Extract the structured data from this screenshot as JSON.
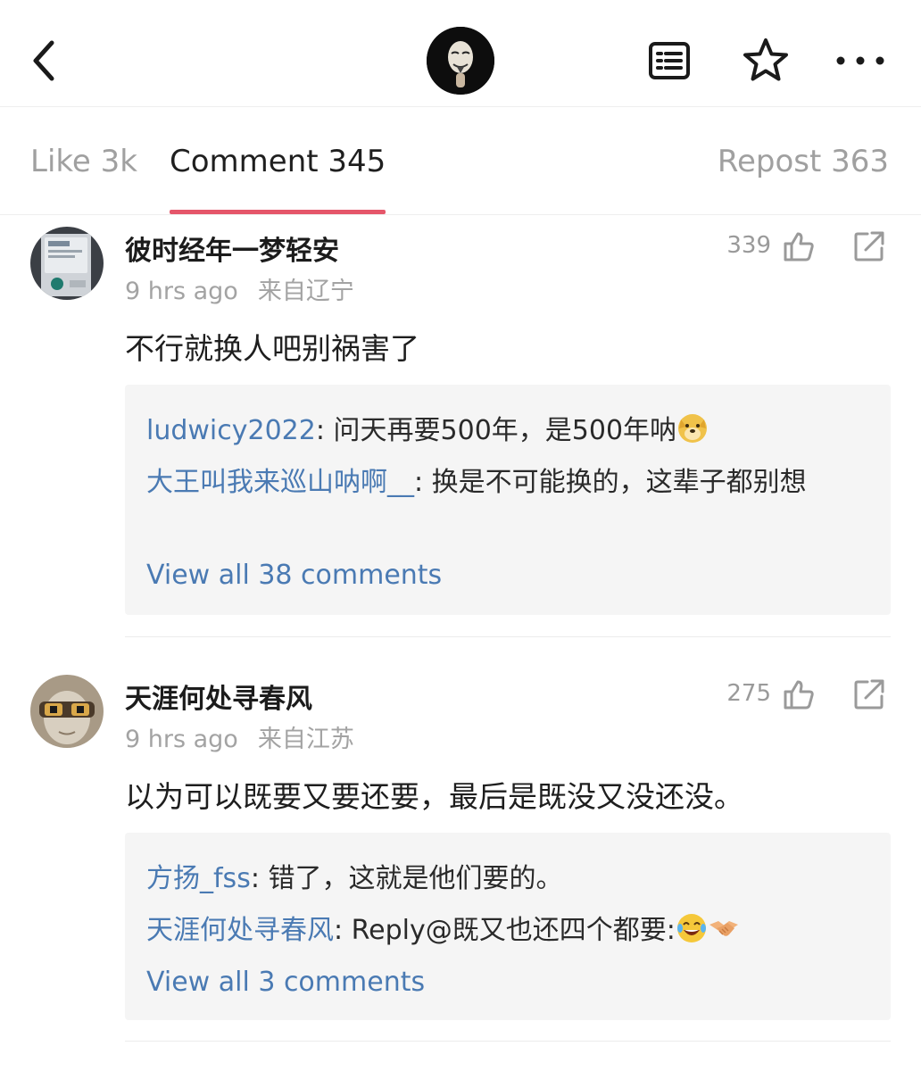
{
  "header": {
    "back_icon": "chevron-left-icon",
    "reader_icon": "reader-icon",
    "star_icon": "star-icon",
    "more_icon": "more-dots-icon"
  },
  "tabs": [
    {
      "label": "Like 3k",
      "active": false
    },
    {
      "label": "Comment 345",
      "active": true
    },
    {
      "label": "Repost 363",
      "active": false
    }
  ],
  "colors": {
    "accent": "#e5566a",
    "link": "#4a7ab3",
    "muted": "#a3a3a3",
    "reply_bg": "#f5f5f5"
  },
  "comments": [
    {
      "username": "彼时经年一梦轻安",
      "time": "9 hrs ago",
      "location": "来自辽宁",
      "likes": "339",
      "text": "不行就换人吧别祸害了",
      "replies": [
        {
          "user": "ludwicy2022",
          "sep": ": ",
          "text": "问天再要500年，是500年呐",
          "emoji": "doge-emoji"
        },
        {
          "user": "大王叫我来巡山呐啊__",
          "sep": ": ",
          "text": "换是不可能换的，这辈子都别想"
        }
      ],
      "view_all": "View all 38 comments"
    },
    {
      "username": "天涯何处寻春风",
      "time": "9 hrs ago",
      "location": "来自江苏",
      "likes": "275",
      "text": "以为可以既要又要还要，最后是既没又没还没。",
      "replies": [
        {
          "user": "方扬_fss",
          "sep": ": ",
          "text": "错了，这就是他们要的。"
        },
        {
          "user": "天涯何处寻春风",
          "sep": ": ",
          "text": "Reply@既又也还四个都要:",
          "emoji": "laugh-cry-emoji handshake-emoji"
        }
      ],
      "view_all": "View all 3 comments"
    }
  ]
}
